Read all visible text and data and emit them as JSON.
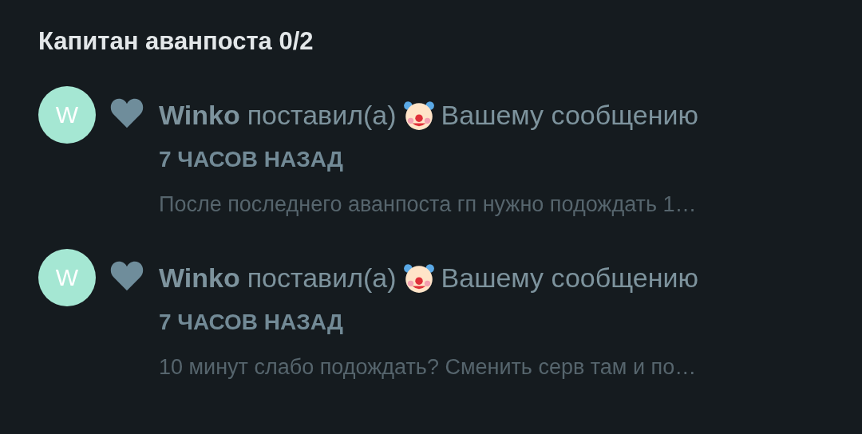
{
  "title": "Капитан аванпоста 0/2",
  "notifications": [
    {
      "avatar_letter": "W",
      "actor": "Winko",
      "action": "поставил(а)",
      "target": "Вашему сообщению",
      "time": "7 ЧАСОВ НАЗАД",
      "preview": "После последнего аванпоста гп нужно подождать 1…"
    },
    {
      "avatar_letter": "W",
      "actor": "Winko",
      "action": "поставил(а)",
      "target": "Вашему сообщению",
      "time": "7 ЧАСОВ НАЗАД",
      "preview": "10 минут слабо подождать? Сменить серв там и по…"
    }
  ]
}
